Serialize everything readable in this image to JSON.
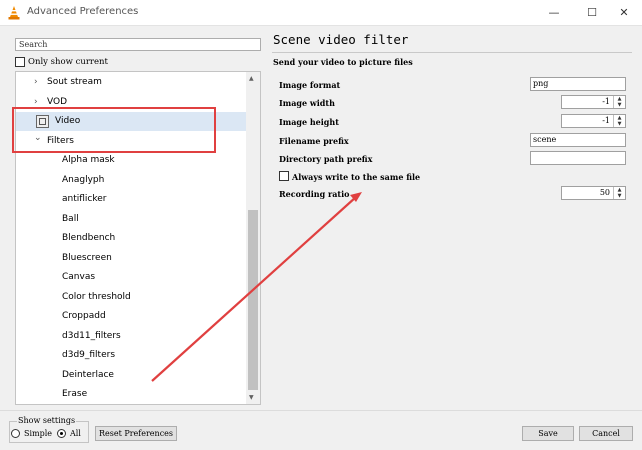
{
  "window": {
    "title": "Advanced Preferences",
    "minimize": "—",
    "maximize": "☐",
    "close": "✕"
  },
  "sidebar": {
    "search_placeholder": "Search",
    "only_show_current": "Only show current",
    "tree": [
      {
        "label": "Sout stream",
        "arrow": "›"
      },
      {
        "label": "VOD",
        "arrow": "›"
      },
      {
        "label": "Video",
        "arrow": "⌄",
        "icon": "video-icon",
        "selected": true
      },
      {
        "label": "Filters",
        "arrow": "⌄"
      },
      {
        "label": "Alpha mask"
      },
      {
        "label": "Anaglyph"
      },
      {
        "label": "antiflicker"
      },
      {
        "label": "Ball"
      },
      {
        "label": "Blendbench"
      },
      {
        "label": "Bluescreen"
      },
      {
        "label": "Canvas"
      },
      {
        "label": "Color threshold"
      },
      {
        "label": "Croppadd"
      },
      {
        "label": "d3d11_filters"
      },
      {
        "label": "d3d9_filters"
      },
      {
        "label": "Deinterlace"
      },
      {
        "label": "Erase"
      }
    ]
  },
  "panel": {
    "title": "Scene video filter",
    "description": "Send your video to picture files",
    "image_format_label": "Image format",
    "image_format_value": "png",
    "image_width_label": "Image width",
    "image_width_value": "-1",
    "image_height_label": "Image height",
    "image_height_value": "-1",
    "filename_prefix_label": "Filename prefix",
    "filename_prefix_value": "scene",
    "directory_prefix_label": "Directory path prefix",
    "directory_prefix_value": "",
    "always_write_label": "Always write to the same file",
    "recording_ratio_label": "Recording ratio",
    "recording_ratio_value": "50"
  },
  "footer": {
    "show_settings": "Show settings",
    "simple": "Simple",
    "all": "All",
    "reset": "Reset Preferences",
    "save": "Save",
    "cancel": "Cancel"
  },
  "colors": {
    "annotation": "#e04040",
    "selection": "#dbe7f4"
  }
}
